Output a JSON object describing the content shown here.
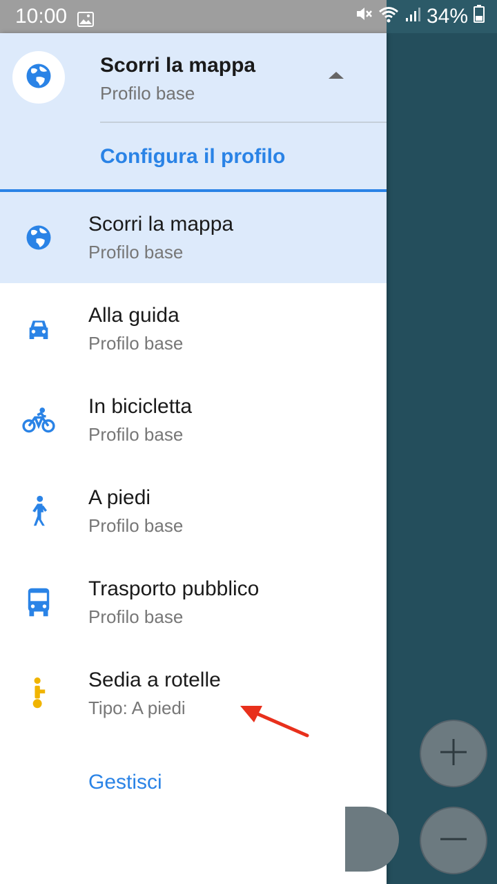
{
  "status_bar": {
    "time": "10:00",
    "battery_percent": "34%",
    "icons": [
      "image-icon",
      "mute-icon",
      "wifi-icon",
      "signal-icon",
      "battery-icon"
    ]
  },
  "drawer": {
    "header": {
      "title": "Scorri la mappa",
      "subtitle": "Profilo base",
      "configure_label": "Configura il profilo",
      "icon": "globe-icon"
    },
    "items": [
      {
        "title": "Scorri la mappa",
        "subtitle": "Profilo base",
        "icon": "globe-icon",
        "selected": true
      },
      {
        "title": "Alla guida",
        "subtitle": "Profilo base",
        "icon": "car-icon",
        "selected": false
      },
      {
        "title": "In bicicletta",
        "subtitle": "Profilo base",
        "icon": "bicycle-icon",
        "selected": false
      },
      {
        "title": "A piedi",
        "subtitle": "Profilo base",
        "icon": "pedestrian-icon",
        "selected": false
      },
      {
        "title": "Trasporto pubblico",
        "subtitle": "Profilo base",
        "icon": "bus-icon",
        "selected": false
      },
      {
        "title": "Sedia a rotelle",
        "subtitle": "Tipo: A piedi",
        "icon": "wheelchair-icon",
        "selected": false
      }
    ],
    "manage_label": "Gestisci"
  },
  "map_controls": {
    "zoom_in_icon": "plus-icon",
    "zoom_out_icon": "minus-icon"
  },
  "colors": {
    "accent": "#2a83e6",
    "header_bg": "#ddeafb",
    "wheelchair_icon": "#f0b400",
    "map_bg": "#244e5c",
    "annotation_arrow": "#e8301c"
  }
}
